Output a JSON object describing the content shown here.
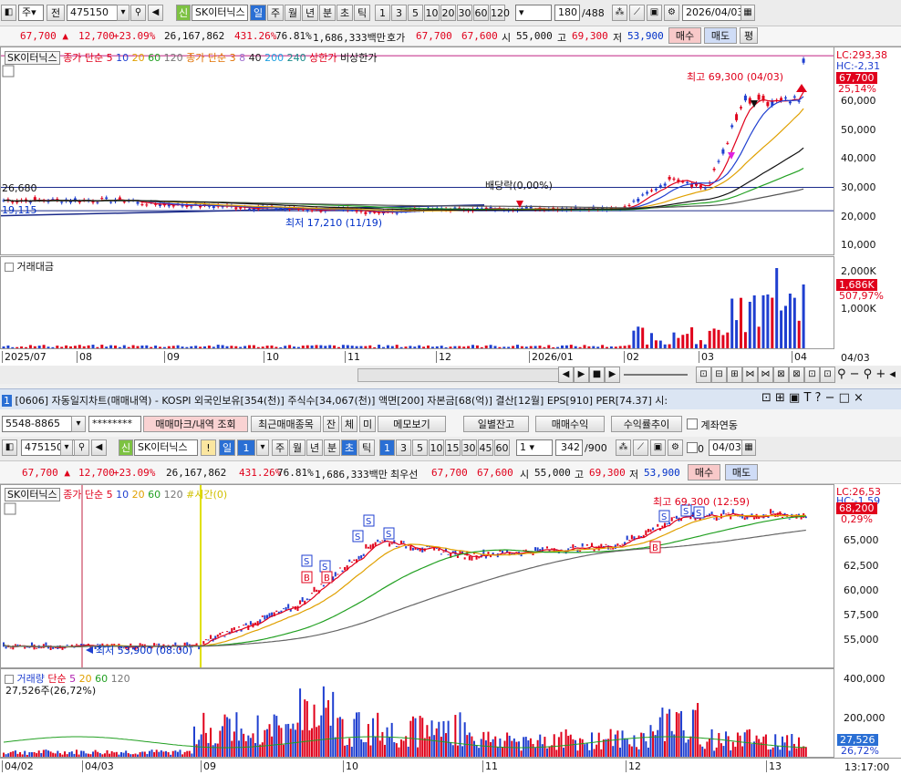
{
  "top": {
    "toolbar": {
      "type_label": "주",
      "jeon_label": "전",
      "code": "475150",
      "sin_label": "신",
      "name": "SK이터닉스",
      "periods": [
        "일",
        "주",
        "월",
        "년",
        "분",
        "초",
        "틱"
      ],
      "minutes": [
        "1",
        "3",
        "5",
        "10",
        "20",
        "30",
        "60",
        "120"
      ],
      "count": "180",
      "count_total": "/488",
      "date": "2026/04/03"
    },
    "quote": {
      "price": "67,700",
      "change": "12,700",
      "change_pct": "+23.09%",
      "volume": "26,167,862",
      "vol_ratio": "431.26%",
      "turnover_rate": "76.81%",
      "amount": "1,686,333백만",
      "hoga_label": "호가",
      "bid": "67,700",
      "ask": "67,600",
      "open_label": "시",
      "open": "55,000",
      "high_label": "고",
      "high": "69,300",
      "low_label": "저",
      "low": "53,900",
      "buy_label": "매수",
      "sell_label": "매도",
      "eval_label": "평"
    },
    "legend": {
      "name": "SK이터닉스",
      "ma_label": "종가 단순",
      "ma_periods": [
        "5",
        "10",
        "20",
        "60",
        "120"
      ],
      "ma2_label": "종가 단순",
      "ma2_periods": [
        "3",
        "8",
        "40",
        "200",
        "240"
      ],
      "upper_label": "상한가",
      "lower_label": "비상한가"
    },
    "annotations": {
      "high": "최고 69,300 (04/03)",
      "low": "최저 17,210 (11/19)",
      "dividend": "배당락(0,00%)",
      "line1": "26,680",
      "line2": "19,115"
    },
    "price_axis": {
      "lc": "LC:293,38",
      "hc": "HC:-2,31",
      "current": "67,700",
      "current_pct": "25,14%",
      "ticks": [
        "60,000",
        "50,000",
        "40,000",
        "30,000",
        "20,000",
        "10,000"
      ]
    },
    "volume_panel": {
      "title": "거래대금",
      "ticks": [
        "2,000K",
        "1,000K"
      ],
      "current": "1,686K",
      "current_pct": "507,97%"
    },
    "x_ticks": [
      "2025/07",
      "08",
      "09",
      "10",
      "11",
      "12",
      "2026/01",
      "02",
      "03",
      "04"
    ],
    "x_end": "04/03"
  },
  "bottom": {
    "title": "[0606] 자동일지차트(매매내역) - KOSPI 외국인보유[354(천)] 주식수[34,067(천)] 액면[200] 자본금[68(억)] 결산[12월] EPS[910] PER[74.37] 시:",
    "account": "5548-8865",
    "password": "********",
    "buttons": [
      "매매마크/내역 조회",
      "최근매매종목",
      "잔",
      "체",
      "미",
      "메모보기",
      "일별잔고",
      "매매수익",
      "수익률추이"
    ],
    "link_label": "계좌연동",
    "toolbar": {
      "code": "475150",
      "sin_label": "신",
      "name": "SK이터닉스",
      "bang": "!",
      "period": "일",
      "period_num": "1",
      "periods": [
        "주",
        "월",
        "년",
        "분",
        "초",
        "틱"
      ],
      "minutes": [
        "1",
        "3",
        "5",
        "10",
        "15",
        "30",
        "45",
        "60"
      ],
      "tick_num": "1",
      "count": "342",
      "count_total": "/900",
      "zero": "0",
      "date": "04/03"
    },
    "quote": {
      "price": "67,700",
      "change": "12,700",
      "change_pct": "+23.09%",
      "volume": "26,167,862",
      "vol_ratio": "431.26%",
      "turnover_rate": "76.81%",
      "amount": "1,686,333백만",
      "hoga_label": "최우선",
      "bid": "67,700",
      "ask": "67,600",
      "open_label": "시",
      "open": "55,000",
      "high_label": "고",
      "high": "69,300",
      "low_label": "저",
      "low": "53,900",
      "buy_label": "매수",
      "sell_label": "매도"
    },
    "legend": {
      "name": "SK이터닉스",
      "ma_label": "종가 단순",
      "ma_periods": [
        "5",
        "10",
        "20",
        "60",
        "120"
      ],
      "time_label": "#시간(0)"
    },
    "annotations": {
      "high": "최고 69,300 (12:59)",
      "low": "최저 53,900 (08:00)"
    },
    "price_axis": {
      "lc": "LC:26,53",
      "hc": "HC:-1,59",
      "current": "68,200",
      "current_pct": "0,29%",
      "ticks": [
        "65,000",
        "62,500",
        "60,000",
        "57,500",
        "55,000"
      ]
    },
    "volume_panel": {
      "title": "거래량",
      "ma_label": "단순",
      "ma_periods": [
        "5",
        "20",
        "60",
        "120"
      ],
      "value": "27,526주(26,72%)",
      "ticks": [
        "400,000",
        "200,000"
      ],
      "current": "27,526",
      "current_pct": "26,72%"
    },
    "x_ticks": [
      "04/02",
      "04/03",
      "09",
      "10",
      "11",
      "12",
      "13"
    ],
    "x_end": "13:17:00"
  }
}
